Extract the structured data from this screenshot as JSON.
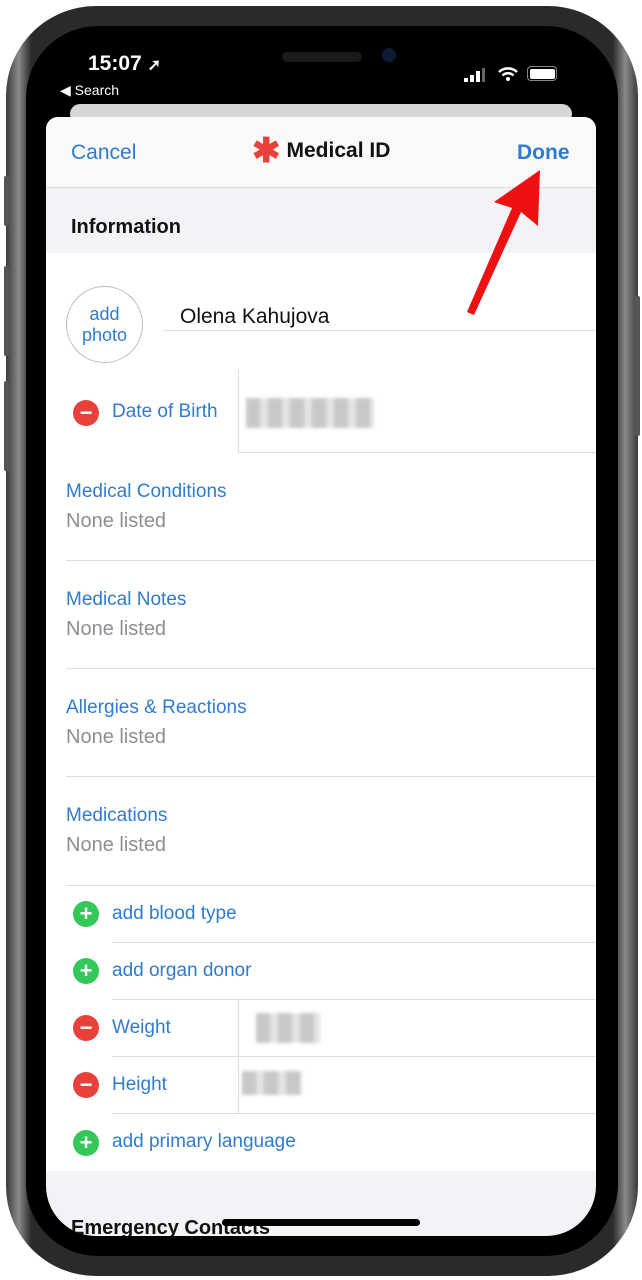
{
  "status_bar": {
    "time": "15:07",
    "back_label": "◀ Search"
  },
  "nav": {
    "cancel": "Cancel",
    "title": "Medical ID",
    "done": "Done",
    "title_icon": "asterisk-icon"
  },
  "section": "Information",
  "profile": {
    "add_photo": "add\nphoto",
    "add_photo_line1": "add",
    "add_photo_line2": "photo",
    "name": "Olena Kahujova"
  },
  "date_of_birth": {
    "label": "Date of Birth"
  },
  "fields": [
    {
      "label": "Medical Conditions",
      "value": "None listed"
    },
    {
      "label": "Medical Notes",
      "value": "None listed"
    },
    {
      "label": "Allergies & Reactions",
      "value": "None listed"
    },
    {
      "label": "Medications",
      "value": "None listed"
    }
  ],
  "rows": [
    {
      "icon": "plus",
      "label": "add blood type"
    },
    {
      "icon": "plus",
      "label": "add organ donor"
    },
    {
      "icon": "minus",
      "label": "Weight"
    },
    {
      "icon": "minus",
      "label": "Height"
    },
    {
      "icon": "plus",
      "label": "add primary language"
    }
  ],
  "next_section": "Emergency Contacts",
  "colors": {
    "accent": "#2f7bd0",
    "remove": "#e8403a",
    "add": "#34c759",
    "annotation_arrow": "#ee1111"
  }
}
